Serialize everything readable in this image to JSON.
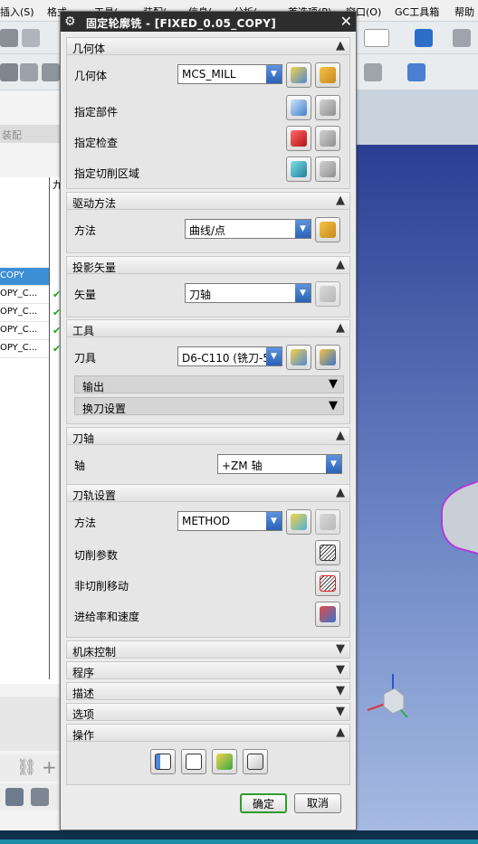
{
  "menubar": {
    "items": [
      "插入(S)",
      "格式",
      "工具(",
      "装配(",
      "信息(",
      "分析(",
      "首选项(P)",
      "窗口(O)",
      "GC工具箱",
      "帮助"
    ]
  },
  "nav": {
    "assembly_label": "装配",
    "rows": [
      "COPY",
      "OPY_C...",
      "OPY_C...",
      "OPY_C...",
      "OPY_C..."
    ],
    "column_header": "九"
  },
  "dialog": {
    "title": "固定轮廓铣 - [FIXED_0.05_COPY]",
    "close_glyph": "✕",
    "geometry": {
      "header": "几何体",
      "geometry_label": "几何体",
      "geometry_value": "MCS_MILL",
      "part_label": "指定部件",
      "check_label": "指定检查",
      "cut_area_label": "指定切削区域"
    },
    "drive": {
      "header": "驱动方法",
      "method_label": "方法",
      "method_value": "曲线/点"
    },
    "projection": {
      "header": "投影矢量",
      "vector_label": "矢量",
      "vector_value": "刀轴"
    },
    "tool": {
      "header": "工具",
      "tool_label": "刀具",
      "tool_value": "D6-C110 (铣刀-5",
      "output_label": "输出",
      "tool_change_label": "换刀设置"
    },
    "tool_axis": {
      "header": "刀轴",
      "axis_label": "轴",
      "axis_value": "+ZM 轴"
    },
    "path": {
      "header": "刀轨设置",
      "method_label": "方法",
      "method_value": "METHOD",
      "cut_params_label": "切削参数",
      "non_cut_label": "非切削移动",
      "feeds_label": "进给率和速度"
    },
    "collapsed": {
      "machine": "机床控制",
      "program": "程序",
      "description": "描述",
      "options": "选项"
    },
    "actions": {
      "header": "操作"
    },
    "ok_label": "确定",
    "cancel_label": "取消"
  },
  "colors": {
    "titlebar": "#2d2d2d",
    "selection": "#3d8fd6",
    "dropdown_arrow": "#2a62b8",
    "ok_border": "#2f9b2f"
  },
  "icons": [
    "gear-icon",
    "close-icon",
    "chevron-up-icon",
    "chevron-down-icon",
    "select-geometry-icon",
    "edit-wrench-icon",
    "part-icon",
    "check-icon",
    "cut-area-icon",
    "generate-icon",
    "replay-icon",
    "verify-icon",
    "list-icon"
  ]
}
